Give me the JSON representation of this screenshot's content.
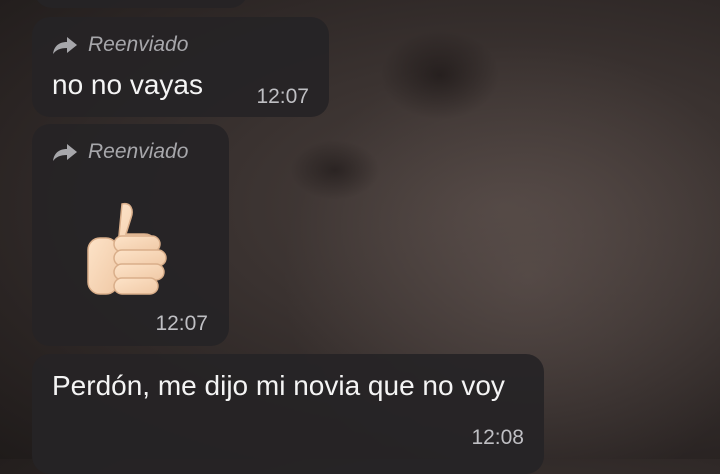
{
  "messages": [
    {
      "forward_label": "Reenviado",
      "text": "no no vayas",
      "time": "12:07"
    },
    {
      "forward_label": "Reenviado",
      "emoji": "thumbs-up",
      "time": "12:07"
    },
    {
      "text": "Perdón, me dijo mi novia que no voy",
      "time": "12:08"
    }
  ],
  "colors": {
    "bubble": "#262426",
    "text": "#f4f4f4",
    "meta": "#a7a7ab"
  }
}
